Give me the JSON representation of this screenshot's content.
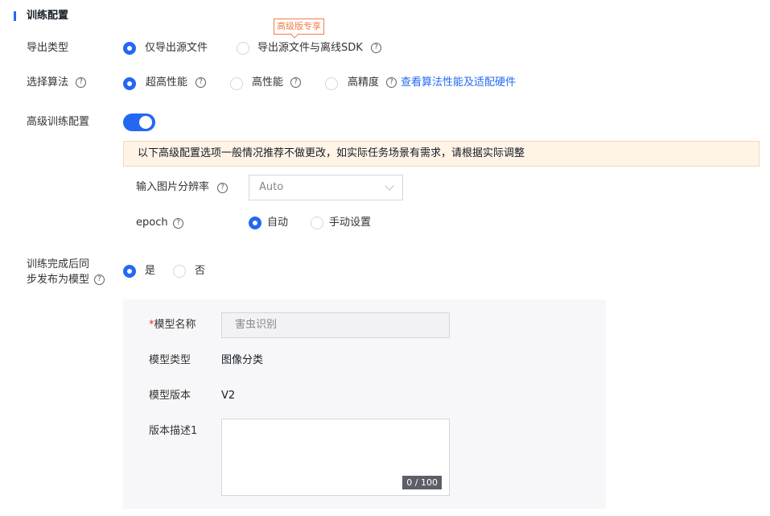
{
  "section": {
    "title": "训练配置"
  },
  "export_type": {
    "label": "导出类型",
    "badge": "高级版专享",
    "options": [
      {
        "label": "仅导出源文件",
        "selected": true
      },
      {
        "label": "导出源文件与离线SDK",
        "selected": false
      }
    ]
  },
  "algorithm": {
    "label": "选择算法",
    "options": [
      {
        "label": "超高性能",
        "selected": true
      },
      {
        "label": "高性能",
        "selected": false
      },
      {
        "label": "高精度",
        "selected": false
      }
    ],
    "link": "查看算法性能及适配硬件"
  },
  "advanced": {
    "label": "高级训练配置",
    "enabled": true,
    "notice": "以下高级配置选项一般情况推荐不做更改，如实际任务场景有需求，请根据实际调整",
    "resolution": {
      "label": "输入图片分辨率",
      "value": "Auto"
    },
    "epoch": {
      "label": "epoch",
      "options": [
        {
          "label": "自动",
          "selected": true
        },
        {
          "label": "手动设置",
          "selected": false
        }
      ]
    }
  },
  "publish": {
    "label_line1": "训练完成后同",
    "label_line2": "步发布为模型",
    "options": [
      {
        "label": "是",
        "selected": true
      },
      {
        "label": "否",
        "selected": false
      }
    ]
  },
  "model": {
    "name_required": "*",
    "name_label": "模型名称",
    "name_value": "害虫识别",
    "type_label": "模型类型",
    "type_value": "图像分类",
    "version_label": "模型版本",
    "version_value": "V2",
    "desc_label": "版本描述1",
    "desc_value": "",
    "desc_counter": "0 / 100"
  },
  "help_glyph": "?",
  "colors": {
    "primary": "#2468f2",
    "badge": "#f27c49",
    "notice_bg": "#fff4e6",
    "required": "#ea2e2e"
  }
}
